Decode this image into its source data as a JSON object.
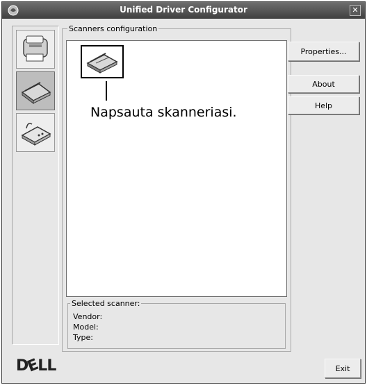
{
  "window": {
    "title": "Unified Driver Configurator",
    "close_glyph": "✕"
  },
  "sidebar": {
    "items": [
      {
        "icon": "printer-icon",
        "active": false
      },
      {
        "icon": "scanner-icon",
        "active": true
      },
      {
        "icon": "ports-icon",
        "active": false
      }
    ]
  },
  "scanners": {
    "group_label": "Scanners configuration",
    "callout": "Napsauta skanneriasi."
  },
  "buttons": {
    "properties": "Properties...",
    "about": "About",
    "help": "Help",
    "exit": "Exit"
  },
  "selected": {
    "title": "Selected scanner:",
    "vendor": "Vendor:",
    "model": "Model:",
    "type": "Type:"
  },
  "brand": {
    "logo": "DELL"
  }
}
